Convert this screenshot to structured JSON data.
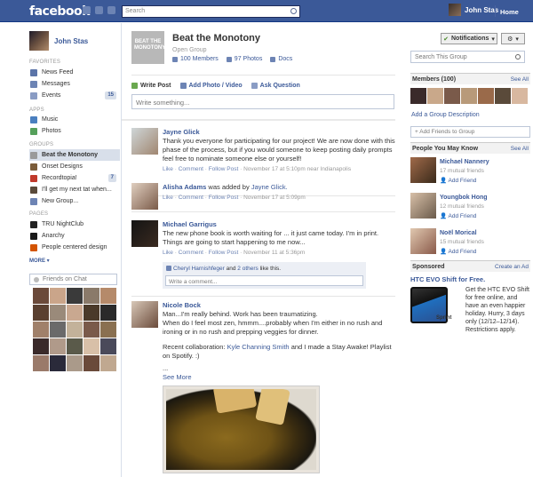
{
  "topbar": {
    "logo": "facebook",
    "search_placeholder": "Search",
    "user_name": "John Stas",
    "home": "Home"
  },
  "left": {
    "user_name": "John Stas",
    "favorites_header": "FAVORITES",
    "favorites": [
      {
        "label": "News Feed",
        "icon": "news-feed-icon",
        "color": "#5b74a8"
      },
      {
        "label": "Messages",
        "icon": "messages-icon",
        "color": "#6d84b4"
      },
      {
        "label": "Events",
        "icon": "events-icon",
        "color": "#8a9cc4",
        "count": "15"
      }
    ],
    "apps_header": "APPS",
    "apps": [
      {
        "label": "Music",
        "icon": "music-icon",
        "color": "#4a7fbf"
      },
      {
        "label": "Photos",
        "icon": "photos-icon",
        "color": "#55a05b"
      }
    ],
    "groups_header": "GROUPS",
    "groups": [
      {
        "label": "Beat the Monotony",
        "color": "#9a9a9a",
        "selected": true
      },
      {
        "label": "Onset Designs",
        "color": "#7a5c3a"
      },
      {
        "label": "Recordtopia!",
        "color": "#c0392b",
        "count": "7"
      },
      {
        "label": "I'll get my next tat when...",
        "color": "#5a4a3a"
      },
      {
        "label": "New Group...",
        "color": "#6d84b4"
      }
    ],
    "pages_header": "PAGES",
    "pages": [
      {
        "label": "TRU NightClub",
        "color": "#222"
      },
      {
        "label": "Anarchy",
        "color": "#1a1a1a"
      },
      {
        "label": "People centered design",
        "color": "#d35400"
      }
    ],
    "more": "MORE",
    "chat_placeholder": "Friends on Chat"
  },
  "group": {
    "pic_text": "BEAT THE MONOTONY",
    "name": "Beat the Monotony",
    "type": "Open Group",
    "members": "100 Members",
    "photos": "97 Photos",
    "docs": "Docs"
  },
  "composer": {
    "write_post": "Write Post",
    "add_photo": "Add Photo / Video",
    "ask_question": "Ask Question",
    "placeholder": "Write something..."
  },
  "posts": [
    {
      "author": "Jayne Glick",
      "text": "Thank you everyone for participating for our project! We are now done with this phase of the process, but if you would someone to keep posting daily prompts feel free to nominate someone else or yourself!",
      "like": "Like",
      "comment": "Comment",
      "follow": "Follow Post",
      "time": "November 17 at 5:10pm near Indianapolis"
    },
    {
      "author": "Alisha Adams",
      "text_mid": "was added by",
      "target": "Jayne Glick.",
      "like": "Like",
      "comment": "Comment",
      "follow": "Follow Post",
      "time": "November 17 at 5:09pm"
    },
    {
      "author": "Michael Garrigus",
      "text": "The new phone book is worth waiting for ... it just came today. I'm in print. Things are going to start happening to me now...",
      "like": "Like",
      "comment": "Comment",
      "follow": "Follow Post",
      "time": "November 11 at 5:36pm",
      "liked_by": "Cheryl Harnishfeger",
      "liked_and": "and",
      "liked_others": "2 others",
      "liked_suffix": "like this.",
      "comment_placeholder": "Write a comment..."
    },
    {
      "author": "Nicole Bock",
      "line1": "Man...I'm really behind. Work has been traumatizing.",
      "line2": "When do I feel most zen, hmmm....probably when I'm either in no rush and ironing or in no rush and prepping veggies for dinner.",
      "line3_pre": "Recent collaboration:",
      "line3_link": "Kyle Channing Smith",
      "line3_post": "and I made a Stay Awake! Playlist on Spotify. :)",
      "ellipsis": "...",
      "see_more": "See More"
    }
  ],
  "right": {
    "notifications": "Notifications",
    "search_placeholder": "Search This Group",
    "members_header": "Members (100)",
    "see_all": "See All",
    "add_description": "Add a Group Description",
    "add_friends": "+ Add Friends to Group",
    "pymk_header": "People You May Know",
    "pymk": [
      {
        "name": "Michael Nannery",
        "mutual": "17 mutual friends",
        "add": "Add Friend"
      },
      {
        "name": "Youngbok Hong",
        "mutual": "12 mutual friends",
        "add": "Add Friend"
      },
      {
        "name": "Noël Morical",
        "mutual": "15 mutual friends",
        "add": "Add Friend"
      }
    ],
    "sponsored_header": "Sponsored",
    "create_ad": "Create an Ad",
    "ad_title": "HTC EVO Shift for Free.",
    "ad_brand": "Sprint",
    "ad_text": "Get the HTC EVO Shift for free online, and have an even happier holiday. Hurry, 3 days only (12/12–12/14). Restrictions apply."
  }
}
